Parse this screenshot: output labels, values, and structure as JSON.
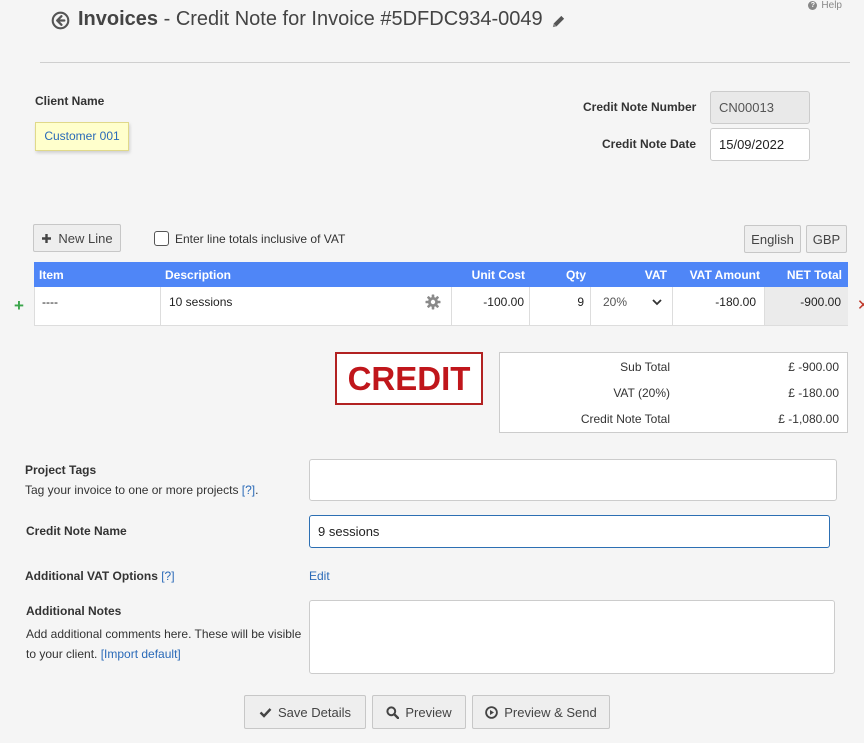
{
  "header": {
    "module": "Invoices",
    "subtitle": " - Credit Note for Invoice #5DFDC934-0049",
    "help": "Help"
  },
  "client": {
    "label": "Client Name",
    "value": "Customer 001"
  },
  "credit_note": {
    "number_label": "Credit Note Number",
    "number": "CN00013",
    "date_label": "Credit Note Date",
    "date": "15/09/2022"
  },
  "toolbar": {
    "new_line": "New Line",
    "inclusive_vat_label": "Enter line totals inclusive of VAT",
    "language": "English",
    "currency": "GBP"
  },
  "table": {
    "columns": [
      "Item",
      "Description",
      "Unit Cost",
      "Qty",
      "VAT",
      "VAT Amount",
      "NET Total"
    ],
    "rows": [
      {
        "item": "----",
        "description": "10 sessions",
        "unit_cost": "-100.00",
        "qty": "9",
        "vat": "20%",
        "vat_amount": "-180.00",
        "net_total": "-900.00"
      }
    ]
  },
  "stamp": "CREDIT",
  "totals": {
    "sub_total_label": "Sub Total",
    "sub_total": "£ -900.00",
    "vat_label": "VAT (20%)",
    "vat": "£ -180.00",
    "total_label": "Credit Note Total",
    "total": "£ -1,080.00"
  },
  "form": {
    "project_tags_label": "Project Tags",
    "project_tags_help": "Tag your invoice to one or more projects ",
    "project_tags_help_link": "[?]",
    "project_tags_help_end": ".",
    "credit_note_name_label": "Credit Note Name",
    "credit_note_name": "9 sessions",
    "vat_options_label": "Additional VAT Options ",
    "vat_options_link": "[?]",
    "vat_options_edit": "Edit",
    "notes_label": "Additional Notes",
    "notes_help": "Add additional comments here. These will be visible to your client. ",
    "notes_help_link": "[Import default]"
  },
  "actions": {
    "save": "Save Details",
    "preview": "Preview",
    "preview_send": "Preview & Send"
  },
  "colors": {
    "table_header": "#4f86f7",
    "stamp": "#c0161b",
    "link": "#2a6ab8",
    "client_note": "#ffffcc"
  }
}
